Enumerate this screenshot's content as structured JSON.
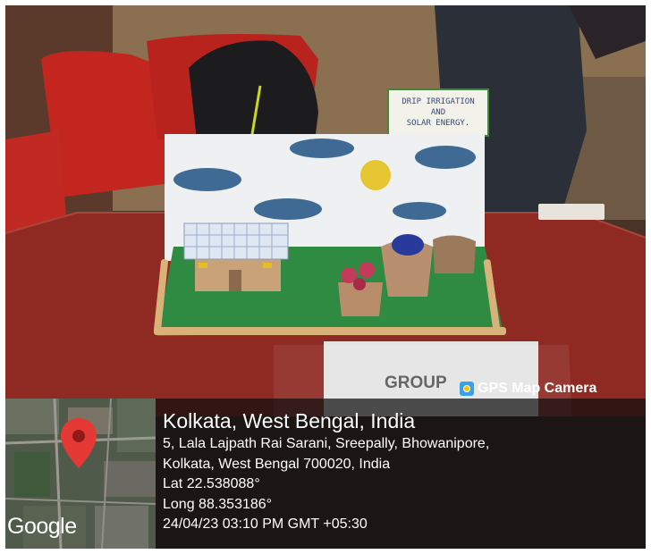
{
  "scene": {
    "sign_text": [
      "DRIP IRRIGATION",
      "AND",
      "SOLAR ENERGY."
    ],
    "group_card_text": "GROUP"
  },
  "gps_badge": {
    "label": "GPS Map Camera",
    "icon": "camera-icon"
  },
  "location": {
    "title": "Kolkata, West Bengal, India",
    "address_line_1": "5, Lala Lajpath Rai Sarani, Sreepally, Bhowanipore,",
    "address_line_2": "Kolkata, West Bengal 700020, India",
    "lat": "Lat 22.538088°",
    "long": "Long 88.353186°",
    "datetime": "24/04/23 03:10 PM GMT +05:30"
  },
  "map": {
    "logo": "Google",
    "pin_icon": "map-pin-icon",
    "pin_color": "#e53935"
  }
}
